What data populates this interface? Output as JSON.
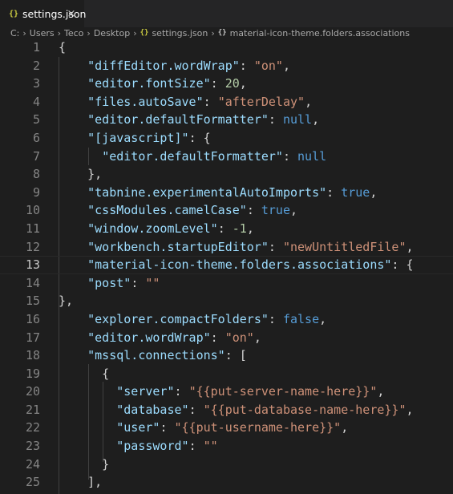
{
  "tab": {
    "icon": "{}",
    "label": "settings.json",
    "close": "×",
    "icon_name": "json-file-icon"
  },
  "breadcrumb": {
    "items": [
      "C:",
      "Users",
      "Teco",
      "Desktop",
      "settings.json",
      "material-icon-theme.folders.associations"
    ],
    "json_icon": "{}",
    "object_icon": "{}"
  },
  "editor": {
    "current_line": 13,
    "lines": [
      {
        "n": "1",
        "tokens": [
          [
            "p",
            "{"
          ]
        ]
      },
      {
        "n": "2",
        "tokens": [
          [
            "p",
            "    "
          ],
          [
            "k",
            "\"diffEditor.wordWrap\""
          ],
          [
            "p",
            ": "
          ],
          [
            "s",
            "\"on\""
          ],
          [
            "p",
            ","
          ]
        ]
      },
      {
        "n": "3",
        "tokens": [
          [
            "p",
            "    "
          ],
          [
            "k",
            "\"editor.fontSize\""
          ],
          [
            "p",
            ": "
          ],
          [
            "n",
            "20"
          ],
          [
            "p",
            ","
          ]
        ]
      },
      {
        "n": "4",
        "tokens": [
          [
            "p",
            "    "
          ],
          [
            "k",
            "\"files.autoSave\""
          ],
          [
            "p",
            ": "
          ],
          [
            "s",
            "\"afterDelay\""
          ],
          [
            "p",
            ","
          ]
        ]
      },
      {
        "n": "5",
        "tokens": [
          [
            "p",
            "    "
          ],
          [
            "k",
            "\"editor.defaultFormatter\""
          ],
          [
            "p",
            ": "
          ],
          [
            "b",
            "null"
          ],
          [
            "p",
            ","
          ]
        ]
      },
      {
        "n": "6",
        "tokens": [
          [
            "p",
            "    "
          ],
          [
            "k",
            "\"[javascript]\""
          ],
          [
            "p",
            ": {"
          ]
        ]
      },
      {
        "n": "7",
        "tokens": [
          [
            "p",
            "      "
          ],
          [
            "k",
            "\"editor.defaultFormatter\""
          ],
          [
            "p",
            ": "
          ],
          [
            "b",
            "null"
          ]
        ]
      },
      {
        "n": "8",
        "tokens": [
          [
            "p",
            "    },"
          ]
        ]
      },
      {
        "n": "9",
        "tokens": [
          [
            "p",
            "    "
          ],
          [
            "k",
            "\"tabnine.experimentalAutoImports\""
          ],
          [
            "p",
            ": "
          ],
          [
            "b",
            "true"
          ],
          [
            "p",
            ","
          ]
        ]
      },
      {
        "n": "10",
        "tokens": [
          [
            "p",
            "    "
          ],
          [
            "k",
            "\"cssModules.camelCase\""
          ],
          [
            "p",
            ": "
          ],
          [
            "b",
            "true"
          ],
          [
            "p",
            ","
          ]
        ]
      },
      {
        "n": "11",
        "tokens": [
          [
            "p",
            "    "
          ],
          [
            "k",
            "\"window.zoomLevel\""
          ],
          [
            "p",
            ": "
          ],
          [
            "n",
            "-1"
          ],
          [
            "p",
            ","
          ]
        ]
      },
      {
        "n": "12",
        "tokens": [
          [
            "p",
            "    "
          ],
          [
            "k",
            "\"workbench.startupEditor\""
          ],
          [
            "p",
            ": "
          ],
          [
            "s",
            "\"newUntitledFile\""
          ],
          [
            "p",
            ","
          ]
        ]
      },
      {
        "n": "13",
        "tokens": [
          [
            "p",
            "    "
          ],
          [
            "k",
            "\"material-icon-theme.folders.associations\""
          ],
          [
            "p",
            ": {"
          ]
        ]
      },
      {
        "n": "14",
        "tokens": [
          [
            "p",
            "    "
          ],
          [
            "k",
            "\"post\""
          ],
          [
            "p",
            ": "
          ],
          [
            "s",
            "\"\""
          ]
        ]
      },
      {
        "n": "15",
        "tokens": [
          [
            "p",
            "},"
          ]
        ]
      },
      {
        "n": "16",
        "tokens": [
          [
            "p",
            "    "
          ],
          [
            "k",
            "\"explorer.compactFolders\""
          ],
          [
            "p",
            ": "
          ],
          [
            "b",
            "false"
          ],
          [
            "p",
            ","
          ]
        ]
      },
      {
        "n": "17",
        "tokens": [
          [
            "p",
            "    "
          ],
          [
            "k",
            "\"editor.wordWrap\""
          ],
          [
            "p",
            ": "
          ],
          [
            "s",
            "\"on\""
          ],
          [
            "p",
            ","
          ]
        ]
      },
      {
        "n": "18",
        "tokens": [
          [
            "p",
            "    "
          ],
          [
            "k",
            "\"mssql.connections\""
          ],
          [
            "p",
            ": ["
          ]
        ]
      },
      {
        "n": "19",
        "tokens": [
          [
            "p",
            "      {"
          ]
        ]
      },
      {
        "n": "20",
        "tokens": [
          [
            "p",
            "        "
          ],
          [
            "k",
            "\"server\""
          ],
          [
            "p",
            ": "
          ],
          [
            "s",
            "\"{{put-server-name-here}}\""
          ],
          [
            "p",
            ","
          ]
        ]
      },
      {
        "n": "21",
        "tokens": [
          [
            "p",
            "        "
          ],
          [
            "k",
            "\"database\""
          ],
          [
            "p",
            ": "
          ],
          [
            "s",
            "\"{{put-database-name-here}}\""
          ],
          [
            "p",
            ","
          ]
        ]
      },
      {
        "n": "22",
        "tokens": [
          [
            "p",
            "        "
          ],
          [
            "k",
            "\"user\""
          ],
          [
            "p",
            ": "
          ],
          [
            "s",
            "\"{{put-username-here}}\""
          ],
          [
            "p",
            ","
          ]
        ]
      },
      {
        "n": "23",
        "tokens": [
          [
            "p",
            "        "
          ],
          [
            "k",
            "\"password\""
          ],
          [
            "p",
            ": "
          ],
          [
            "s",
            "\"\""
          ]
        ]
      },
      {
        "n": "24",
        "tokens": [
          [
            "p",
            "      }"
          ]
        ]
      },
      {
        "n": "25",
        "tokens": [
          [
            "p",
            "    ],"
          ]
        ]
      }
    ]
  },
  "colors": {
    "background": "#1e1e1e",
    "key": "#9cdcfe",
    "string": "#ce9178",
    "number": "#b5cea8",
    "keyword": "#569cd6",
    "punctuation": "#d4d4d4",
    "line_number": "#858585"
  }
}
